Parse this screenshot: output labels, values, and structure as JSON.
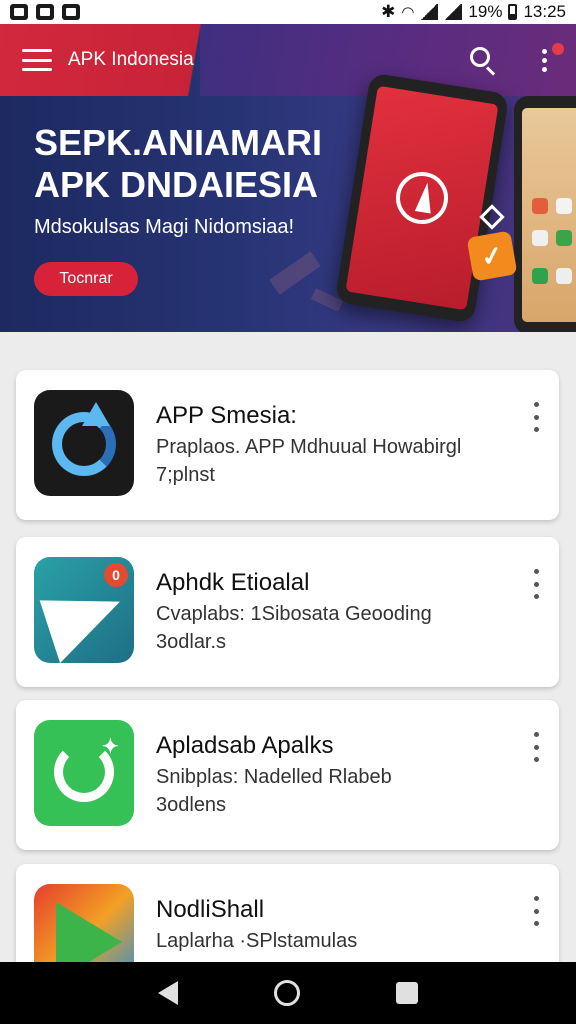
{
  "status_bar": {
    "battery_percent": "19%",
    "time": "13:25",
    "icons": [
      "image-icon",
      "gallery-icon",
      "message-icon",
      "bluetooth-icon",
      "wifi-icon",
      "signal-icon",
      "signal-icon",
      "battery-icon"
    ]
  },
  "app_bar": {
    "title": "APK Indonesia",
    "icons": [
      "menu-icon",
      "search-icon",
      "more-vert-icon"
    ]
  },
  "hero": {
    "title_line1": "SEPK.ANIAMARI",
    "title_line2": "APK DNDAIESIA",
    "subtitle": "Mdsokulsas Magi Nidomsiaa!",
    "cta_label": "Tocnrar"
  },
  "apps": [
    {
      "name": "APP Smesia:",
      "desc": "Praplaos. APP Mdhuual Howabirgl",
      "size": "7;plnst",
      "icon": "sync-app-icon"
    },
    {
      "name": "Aphdk Etioalal",
      "desc": "Cvaplabs: 1Sibosata Geooding",
      "size": "3odlar.s",
      "icon": "send-app-icon",
      "badge": "0"
    },
    {
      "name": "Apladsab Apalks",
      "desc": "Snibplas: Nadelled Rlabeb",
      "size": "3odlens",
      "icon": "chat-app-icon"
    },
    {
      "name": "NodliShall",
      "desc": "Laplarha  ·SPlstamulas",
      "size": "",
      "icon": "play-app-icon"
    }
  ],
  "colors": {
    "accent_red": "#d3283d",
    "hero_navy": "#283576",
    "page_bg": "#ececec"
  }
}
